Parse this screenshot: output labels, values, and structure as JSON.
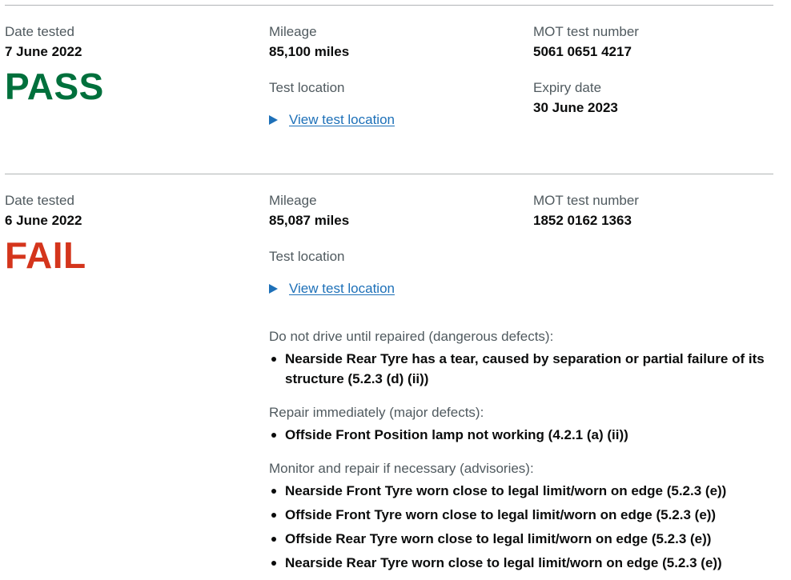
{
  "records": [
    {
      "date_label": "Date tested",
      "date": "7 June 2022",
      "result": "PASS",
      "mileage_label": "Mileage",
      "mileage": "85,100 miles",
      "location_label": "Test location",
      "location_link": "View test location",
      "test_number_label": "MOT test number",
      "test_number": "5061 0651 4217",
      "expiry_label": "Expiry date",
      "expiry": "30 June 2023"
    },
    {
      "date_label": "Date tested",
      "date": "6 June 2022",
      "result": "FAIL",
      "mileage_label": "Mileage",
      "mileage": "85,087 miles",
      "location_label": "Test location",
      "location_link": "View test location",
      "test_number_label": "MOT test number",
      "test_number": "1852 0162 1363",
      "defects": {
        "dangerous": {
          "heading": "Do not drive until repaired (dangerous defects):",
          "items": [
            "Nearside Rear Tyre has a tear, caused by separation or partial failure of its structure (5.2.3 (d) (ii))"
          ]
        },
        "major": {
          "heading": "Repair immediately (major defects):",
          "items": [
            "Offside Front Position lamp not working (4.2.1 (a) (ii))"
          ]
        },
        "advisories": {
          "heading": "Monitor and repair if necessary (advisories):",
          "items": [
            "Nearside Front Tyre worn close to legal limit/worn on edge (5.2.3 (e))",
            "Offside Front Tyre worn close to legal limit/worn on edge (5.2.3 (e))",
            "Offside Rear Tyre worn close to legal limit/worn on edge (5.2.3 (e))",
            "Nearside Rear Tyre worn close to legal limit/worn on edge (5.2.3 (e))"
          ]
        }
      }
    }
  ],
  "colors": {
    "pass": "#00703c",
    "fail": "#d4351c",
    "link": "#1d70b8",
    "secondary_text": "#505a5f",
    "divider": "#b1b4b6"
  },
  "icons": {
    "details_toggle": "caret-right-icon",
    "list_bullet": "bullet-icon"
  }
}
